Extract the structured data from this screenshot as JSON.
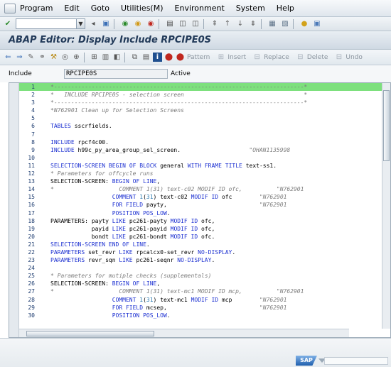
{
  "menubar": {
    "items": [
      "Program",
      "Edit",
      "Goto",
      "Utilities(M)",
      "Environment",
      "System",
      "Help"
    ]
  },
  "title": "ABAP Editor: Display Include RPCIPE0S",
  "toolbar": {
    "pattern": "Pattern",
    "insert": "Insert",
    "replace": "Replace",
    "delete": "Delete",
    "undo": "Undo"
  },
  "include": {
    "label": "Include",
    "value": "RPCIPE0S",
    "status": "Active"
  },
  "code_lines": [
    {
      "n": "1",
      "t": "*-------------------------------------------------------------------------*",
      "c": "hl"
    },
    {
      "n": "2",
      "t": "*   INCLUDE RPCIPE0S - selection screen                                   *",
      "c": "cm"
    },
    {
      "n": "3",
      "t": "*-------------------------------------------------------------------------*",
      "c": "cm"
    },
    {
      "n": "4",
      "t": "*N762901 Clean up for Selection Screens",
      "c": "cm"
    },
    {
      "n": "5",
      "t": "",
      "c": ""
    },
    {
      "n": "6",
      "t": "TABLES sscrfields.",
      "c": ""
    },
    {
      "n": "7",
      "t": "",
      "c": ""
    },
    {
      "n": "8",
      "t": "INCLUDE rpcf4c00.",
      "c": ""
    },
    {
      "n": "9",
      "t": "INCLUDE h99c_py_area_group_sel_screen.                    \"OHAN1135998",
      "c": ""
    },
    {
      "n": "10",
      "t": "",
      "c": ""
    },
    {
      "n": "11",
      "t": "SELECTION-SCREEN BEGIN OF BLOCK general WITH FRAME TITLE text-ss1.",
      "c": ""
    },
    {
      "n": "12",
      "t": "* Parameters for offcycle runs",
      "c": "cm"
    },
    {
      "n": "13",
      "t": "SELECTION-SCREEN: BEGIN OF LINE,",
      "c": ""
    },
    {
      "n": "14",
      "t": "*                   COMMENT 1(31) text-c02 MODIF ID ofc,          \"N762901",
      "c": "cm"
    },
    {
      "n": "15",
      "t": "                  COMMENT 1(31) text-c02 MODIF ID ofc        \"N762901",
      "c": ""
    },
    {
      "n": "16",
      "t": "                  FOR FIELD payty,                           \"N762901",
      "c": ""
    },
    {
      "n": "17",
      "t": "                  POSITION POS_LOW.",
      "c": ""
    },
    {
      "n": "18",
      "t": "PARAMETERS: payty LIKE pc261-payty MODIF ID ofc,",
      "c": ""
    },
    {
      "n": "19",
      "t": "            payid LIKE pc261-payid MODIF ID ofc,",
      "c": ""
    },
    {
      "n": "20",
      "t": "            bondt LIKE pc261-bondt MODIF ID ofc.",
      "c": ""
    },
    {
      "n": "21",
      "t": "SELECTION-SCREEN END OF LINE.",
      "c": ""
    },
    {
      "n": "22",
      "t": "PARAMETERS set_revr LIKE rpcalcx0-set_revr NO-DISPLAY.",
      "c": ""
    },
    {
      "n": "23",
      "t": "PARAMETERS revr_sqn LIKE pc261-seqnr NO-DISPLAY.",
      "c": ""
    },
    {
      "n": "24",
      "t": "",
      "c": ""
    },
    {
      "n": "25",
      "t": "* Parameters for mutiple checks (supplementals)",
      "c": "cm"
    },
    {
      "n": "26",
      "t": "SELECTION-SCREEN: BEGIN OF LINE,",
      "c": ""
    },
    {
      "n": "27",
      "t": "*                   COMMENT 1(31) text-mc1 MODIF ID mcp,          \"N762901",
      "c": "cm"
    },
    {
      "n": "28",
      "t": "                  COMMENT 1(31) text-mc1 MODIF ID mcp        \"N762901",
      "c": ""
    },
    {
      "n": "29",
      "t": "                  FOR FIELD mcsep,                           \"N762901",
      "c": ""
    },
    {
      "n": "30",
      "t": "                  POSITION POS_LOW.",
      "c": ""
    }
  ],
  "status": {
    "logo": "SAP"
  }
}
